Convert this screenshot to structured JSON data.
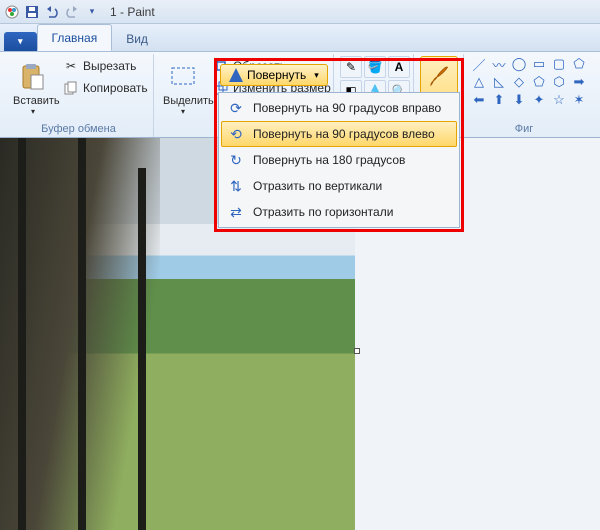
{
  "title": "1 - Paint",
  "tabs": {
    "file": "",
    "home": "Главная",
    "view": "Вид"
  },
  "clipboard": {
    "paste": "Вставить",
    "cut": "Вырезать",
    "copy": "Копировать",
    "group": "Буфер обмена"
  },
  "image": {
    "select": "Выделить",
    "crop": "Обрезать",
    "resize": "Изменить размер",
    "rotate": "Повернуть"
  },
  "rotate_menu": {
    "r90r": "Повернуть на 90 градусов вправо",
    "r90l": "Повернуть на 90 градусов влево",
    "r180": "Повернуть на 180 градусов",
    "flipv": "Отразить по вертикали",
    "fliph": "Отразить по горизонтали"
  },
  "brushes": "Кисти",
  "shapes_group": "Фиг"
}
